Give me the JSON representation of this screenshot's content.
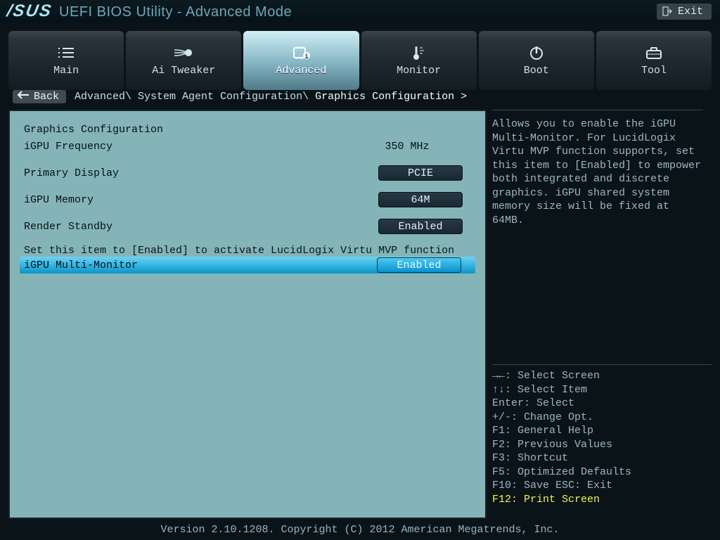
{
  "header": {
    "brand": "/SUS",
    "title": "UEFI BIOS Utility - Advanced Mode",
    "exit": "Exit"
  },
  "tabs": [
    {
      "label": "Main"
    },
    {
      "label": "Ai Tweaker"
    },
    {
      "label": "Advanced",
      "active": true
    },
    {
      "label": "Monitor"
    },
    {
      "label": "Boot"
    },
    {
      "label": "Tool"
    }
  ],
  "back_label": "Back",
  "breadcrumb": {
    "seg1": "Advanced\\",
    "seg2": " System Agent Configuration\\",
    "current": " Graphics Configuration >"
  },
  "settings": {
    "heading": "Graphics Configuration",
    "igpu_freq_label": "iGPU Frequency",
    "igpu_freq_value": "350 MHz",
    "primary_display_label": "Primary Display",
    "primary_display_value": "PCIE",
    "igpu_memory_label": "iGPU Memory",
    "igpu_memory_value": "64M",
    "render_standby_label": "Render Standby",
    "render_standby_value": "Enabled",
    "hint": "Set this item to [Enabled] to activate LucidLogix Virtu MVP function",
    "igpu_mm_label": "iGPU Multi-Monitor",
    "igpu_mm_value": "Enabled"
  },
  "help": {
    "text": "Allows you to enable the iGPU Multi-Monitor. For LucidLogix Virtu MVP function supports, set this item to [Enabled] to empower both integrated and discrete graphics. iGPU shared system memory size will be fixed at 64MB."
  },
  "keys": {
    "k1": "→←: Select Screen",
    "k2": "↑↓: Select Item",
    "k3": "Enter: Select",
    "k4": "+/-: Change Opt.",
    "k5": "F1: General Help",
    "k6": "F2: Previous Values",
    "k7": "F3: Shortcut",
    "k8": "F5: Optimized Defaults",
    "k9": "F10: Save  ESC: Exit",
    "k10": "F12: Print Screen"
  },
  "footer": "Version 2.10.1208. Copyright (C) 2012 American Megatrends, Inc."
}
